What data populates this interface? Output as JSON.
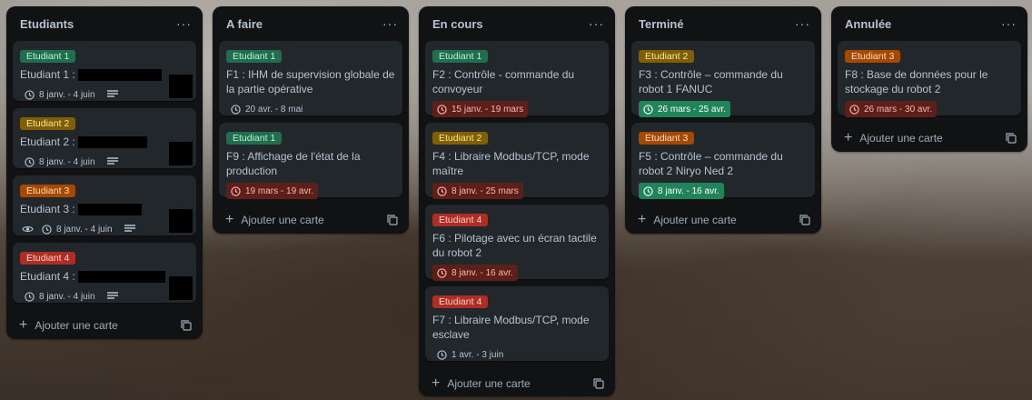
{
  "columns": [
    {
      "title": "Etudiants",
      "menu": "···",
      "add_label": "Ajouter une carte",
      "cards": [
        {
          "label": "Etudiant 1",
          "title": "Etudiant 1 :",
          "dates": "8 janv. - 4 juin"
        },
        {
          "label": "Etudiant 2",
          "title": "Etudiant 2 :",
          "dates": "8 janv. - 4 juin"
        },
        {
          "label": "Etudiant 3",
          "title": "Etudiant 3 :",
          "dates": "8 janv. - 4 juin"
        },
        {
          "label": "Etudiant 4",
          "title": "Etudiant 4 :",
          "dates": "8 janv. - 4 juin"
        }
      ]
    },
    {
      "title": "A faire",
      "menu": "···",
      "add_label": "Ajouter une carte",
      "cards": [
        {
          "label": "Etudiant 1",
          "title": "F1 : IHM de supervision globale de la partie opérative",
          "dates": "20 avr. - 8 mai"
        },
        {
          "label": "Etudiant 1",
          "title": "F9 : Affichage de l'état de la production",
          "dates": "19 mars - 19 avr."
        }
      ]
    },
    {
      "title": "En cours",
      "menu": "···",
      "add_label": "Ajouter une carte",
      "cards": [
        {
          "label": "Etudiant 1",
          "title": "F2 : Contrôle - commande du convoyeur",
          "dates": "15 janv. - 19 mars"
        },
        {
          "label": "Etudiant 2",
          "title": "F4 : Libraire Modbus/TCP, mode maître",
          "dates": "8 janv. - 25 mars"
        },
        {
          "label": "Etudiant 4",
          "title": "F6 : Pilotage avec un écran tactile du robot 2",
          "dates": "8 janv. - 16 avr."
        },
        {
          "label": "Etudiant 4",
          "title": "F7 : Libraire Modbus/TCP, mode esclave",
          "dates": "1 avr. - 3 juin"
        }
      ]
    },
    {
      "title": "Terminé",
      "menu": "···",
      "add_label": "Ajouter une carte",
      "cards": [
        {
          "label": "Etudiant 2",
          "title": "F3 : Contrôle – commande du robot 1 FANUC",
          "dates": "26 mars - 25 avr."
        },
        {
          "label": "Etudiant 3",
          "title": "F5 : Contrôle – commande du robot 2 Niryo Ned 2",
          "dates": "8 janv. - 16 avr."
        }
      ]
    },
    {
      "title": "Annulée",
      "menu": "···",
      "add_label": "Ajouter une carte",
      "cards": [
        {
          "label": "Etudiant 3",
          "title": "F8 : Base de données pour le stockage du robot 2",
          "dates": "26 mars - 30 avr."
        }
      ]
    }
  ],
  "colors": {
    "label_green": "#216e4e",
    "label_yellow": "#7f5f01",
    "label_orange": "#a54800",
    "label_red": "#ae2e24",
    "date_overdue": "#5d1f1a",
    "date_done": "#1f845a",
    "column_bg": "#111213",
    "card_bg": "#22272b"
  },
  "icons": [
    "clock-icon",
    "description-icon",
    "eye-icon",
    "plus-icon",
    "template-icon",
    "menu-dots-icon"
  ]
}
